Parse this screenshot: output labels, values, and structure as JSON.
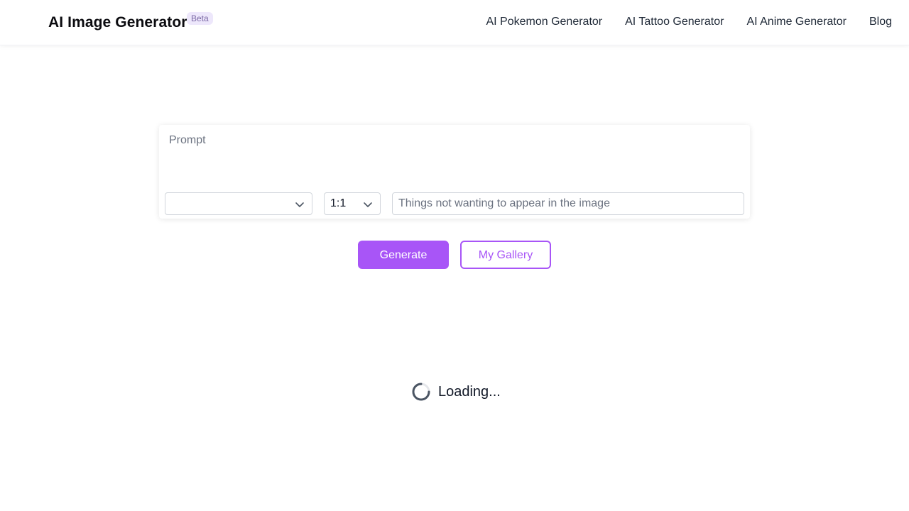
{
  "header": {
    "brand": "AI Image Generator",
    "badge": "Beta",
    "nav": [
      {
        "label": "AI Pokemon Generator"
      },
      {
        "label": "AI Tattoo Generator"
      },
      {
        "label": "AI Anime Generator"
      },
      {
        "label": "Blog"
      }
    ]
  },
  "form": {
    "prompt_placeholder": "Prompt",
    "prompt_value": "",
    "model_select_value": "",
    "ratio_select_value": "1:1",
    "negative_placeholder": "Things not wanting to appear in the image",
    "negative_value": ""
  },
  "actions": {
    "generate_label": "Generate",
    "gallery_label": "My Gallery"
  },
  "status": {
    "loading_text": "Loading..."
  },
  "colors": {
    "accent": "#a855f7",
    "badge_bg": "#ede7fb",
    "text": "#111827"
  },
  "icons": {
    "select_chevron": "chevron-down-icon",
    "loading": "spinner-icon"
  }
}
